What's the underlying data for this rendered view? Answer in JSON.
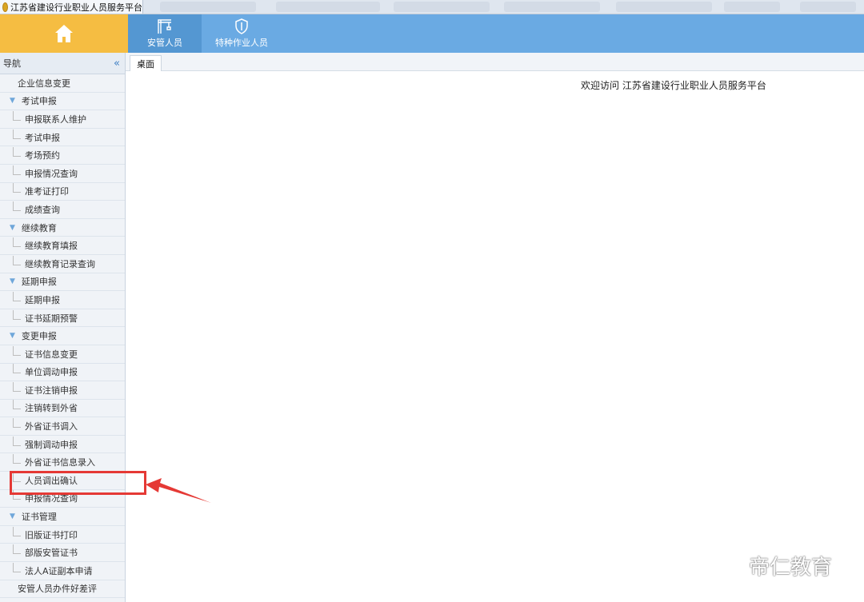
{
  "browser": {
    "active_tab_title": "江苏省建设行业职业人员服务平台"
  },
  "header": {
    "nav": [
      {
        "label": "安管人员"
      },
      {
        "label": "特种作业人员"
      }
    ]
  },
  "sidebar": {
    "title": "导航",
    "collapse_glyph": "«",
    "items": [
      {
        "type": "plain",
        "label": "企业信息变更"
      },
      {
        "type": "group",
        "label": "考试申报"
      },
      {
        "type": "child",
        "label": "申报联系人维护"
      },
      {
        "type": "child",
        "label": "考试申报"
      },
      {
        "type": "child",
        "label": "考场预约"
      },
      {
        "type": "child",
        "label": "申报情况查询"
      },
      {
        "type": "child",
        "label": "准考证打印"
      },
      {
        "type": "child",
        "label": "成绩查询"
      },
      {
        "type": "group",
        "label": "继续教育"
      },
      {
        "type": "child",
        "label": "继续教育填报"
      },
      {
        "type": "child",
        "label": "继续教育记录查询"
      },
      {
        "type": "group",
        "label": "延期申报"
      },
      {
        "type": "child",
        "label": "延期申报"
      },
      {
        "type": "child",
        "label": "证书延期预警"
      },
      {
        "type": "group",
        "label": "变更申报"
      },
      {
        "type": "child",
        "label": "证书信息变更"
      },
      {
        "type": "child",
        "label": "单位调动申报"
      },
      {
        "type": "child",
        "label": "证书注销申报"
      },
      {
        "type": "child",
        "label": "注销转到外省"
      },
      {
        "type": "child",
        "label": "外省证书调入"
      },
      {
        "type": "child",
        "label": "强制调动申报"
      },
      {
        "type": "child",
        "label": "外省证书信息录入"
      },
      {
        "type": "child",
        "label": "人员调出确认"
      },
      {
        "type": "child",
        "label": "申报情况查询"
      },
      {
        "type": "group",
        "label": "证书管理"
      },
      {
        "type": "child",
        "label": "旧版证书打印"
      },
      {
        "type": "child",
        "label": "部版安管证书"
      },
      {
        "type": "child",
        "label": "法人A证副本申请"
      },
      {
        "type": "plain",
        "label": "安管人员办件好差评"
      }
    ]
  },
  "content": {
    "tab": "桌面",
    "welcome": "欢迎访问 江苏省建设行业职业人员服务平台"
  },
  "watermark": {
    "text": "帝仁教育"
  },
  "colors": {
    "header": "#6aaae3",
    "home": "#f5bd42",
    "highlight": "#e53935"
  }
}
